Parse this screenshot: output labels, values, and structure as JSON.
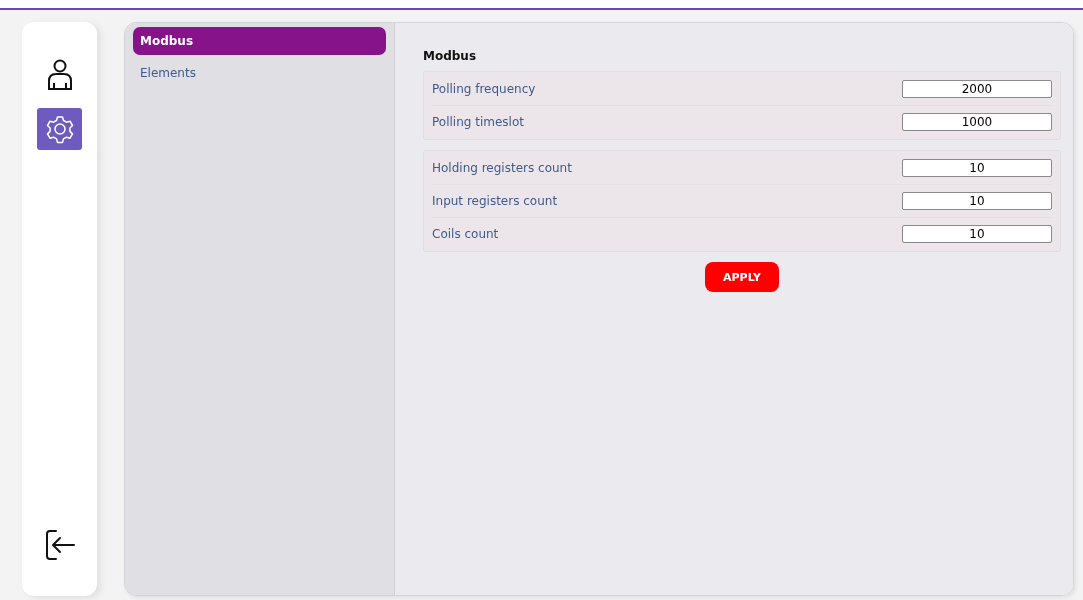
{
  "rail": [
    {
      "kind": "user",
      "selected": false
    },
    {
      "kind": "settings",
      "selected": true
    }
  ],
  "rail_bottom": {
    "kind": "logout"
  },
  "menu": [
    {
      "label": "Modbus",
      "selected": true
    },
    {
      "label": "Elements",
      "selected": false
    }
  ],
  "content": {
    "title": "Modbus",
    "groups": [
      {
        "fields": [
          {
            "label": "Polling frequency",
            "value": "2000"
          },
          {
            "label": "Polling timeslot",
            "value": "1000"
          }
        ]
      },
      {
        "fields": [
          {
            "label": "Holding registers count",
            "value": "10"
          },
          {
            "label": "Input registers count",
            "value": "10"
          },
          {
            "label": "Coils count",
            "value": "10"
          }
        ]
      }
    ],
    "apply": "APPLY"
  }
}
